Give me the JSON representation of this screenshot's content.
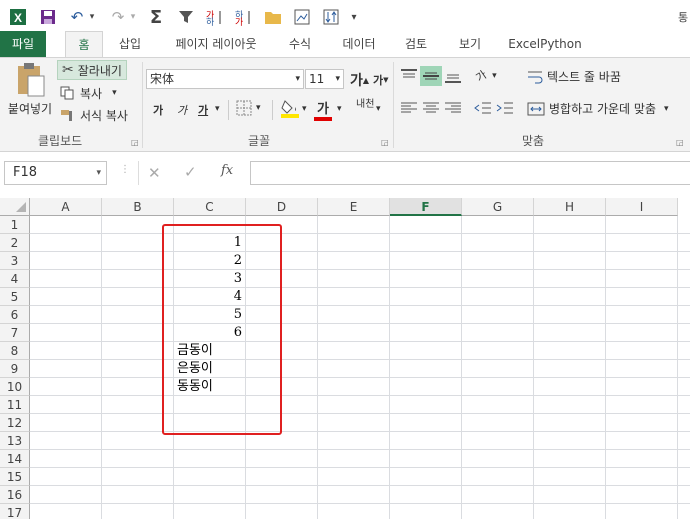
{
  "qat": {
    "save_icon": "save-icon",
    "undo_icon": "undo-icon",
    "redo_icon": "redo-icon",
    "autosum": "Σ",
    "sort_asc": "↓",
    "sort_desc": "↑",
    "more": "▾",
    "title_fragment": "통"
  },
  "tabs": [
    "파일",
    "홈",
    "삽입",
    "페이지 레이아웃",
    "수식",
    "데이터",
    "검토",
    "보기",
    "ExcelPython"
  ],
  "clipboard": {
    "paste": "붙여넣기",
    "cut": "잘라내기",
    "copy": "복사",
    "format_painter": "서식 복사",
    "group": "클립보드"
  },
  "font": {
    "name": "宋体",
    "size": "11",
    "grow": "가",
    "shrink": "가",
    "bold": "가",
    "italic": "가",
    "underline": "가",
    "color": "가",
    "phonetic": "내천",
    "group": "글꼴"
  },
  "alignment": {
    "wrap": "텍스트 줄 바꿈",
    "merge": "병합하고 가운데 맞춤",
    "group": "맞춤",
    "orientation": "가"
  },
  "formula_bar": {
    "name_box": "F18",
    "fx": "fx",
    "value": ""
  },
  "columns": [
    "A",
    "B",
    "C",
    "D",
    "E",
    "F",
    "G",
    "H",
    "I"
  ],
  "active_column": "F",
  "rows": [
    "1",
    "2",
    "3",
    "4",
    "5",
    "6",
    "7",
    "8",
    "9",
    "10",
    "11",
    "12",
    "13",
    "14",
    "15",
    "16",
    "17"
  ],
  "cells": {
    "C2": "1",
    "C3": "2",
    "C4": "3",
    "C5": "4",
    "C6": "5",
    "C7": "6",
    "C8": "금동이",
    "C9": "은동이",
    "C10": "동동이"
  },
  "colors": {
    "excel_green": "#217346",
    "highlight_border": "#e02020",
    "fill_yellow": "#ffe600",
    "font_red": "#e00000"
  }
}
